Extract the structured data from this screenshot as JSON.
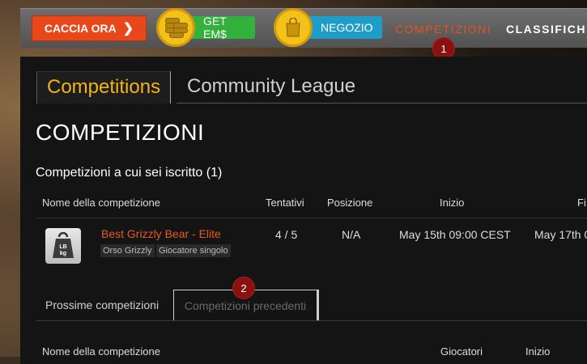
{
  "nav": {
    "hunt_label": "CACCIA ORA",
    "getem_label": "GET EM$",
    "shop_label": "NEGOZIO",
    "competitions_label": "COMPETIZIONI",
    "rankings_label": "CLASSIFICH",
    "accent": "#e8521a"
  },
  "badges": {
    "one": "1",
    "two": "2"
  },
  "tabs": {
    "competitions": "Competitions",
    "league": "Community League"
  },
  "page": {
    "title": "COMPETIZIONI",
    "enrolled_heading": "Competizioni a cui sei iscritto (1)"
  },
  "enrolled_table": {
    "headers": [
      "Nome della competizione",
      "Tentativi",
      "Posizione",
      "Inizio",
      "Fi"
    ],
    "rows": [
      {
        "icon": "weight-icon",
        "icon_text": "LB kg",
        "name": "Best Grizzly Bear - Elite",
        "tags": [
          "Orso Grizzly",
          "Giocatore singolo"
        ],
        "attempts": "4 / 5",
        "position": "N/A",
        "start": "May 15th 09:00 CEST",
        "end": "May 17th 0"
      }
    ]
  },
  "subtabs": {
    "next": "Prossime competizioni",
    "previous": "Competizioni precedenti"
  },
  "previous_table": {
    "headers": [
      "Nome della competizione",
      "Giocatori",
      "Inizio"
    ]
  }
}
